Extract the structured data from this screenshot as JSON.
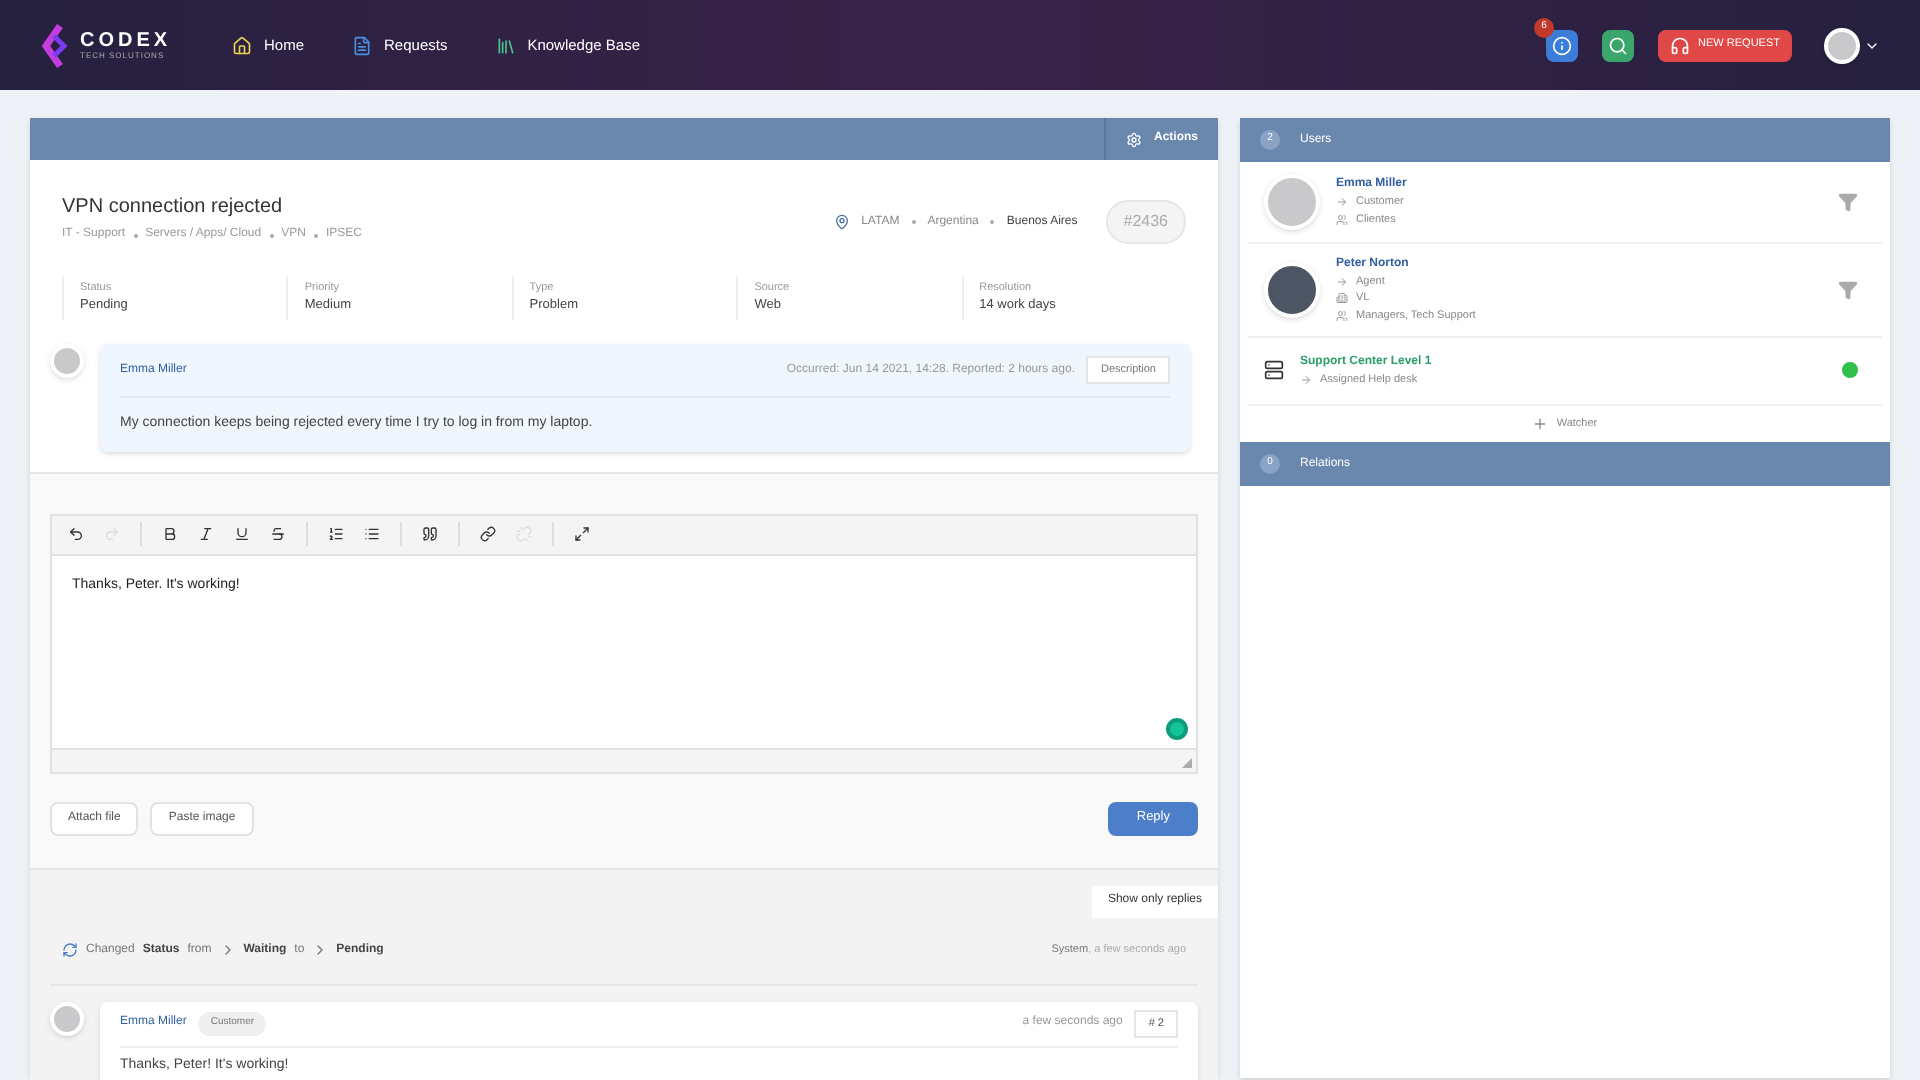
{
  "header": {
    "logo_name": "CODEX",
    "logo_tagline": "TECH SOLUTIONS",
    "nav": [
      {
        "label": "Home",
        "kind": "home"
      },
      {
        "label": "Requests",
        "kind": "requests"
      },
      {
        "label": "Knowledge Base",
        "kind": "books"
      }
    ],
    "notification_count": "6",
    "new_request": "NEW REQUEST"
  },
  "ticket": {
    "actions": "Actions",
    "title": "VPN connection rejected",
    "breadcrumb": [
      "IT - Support",
      "Servers / Apps/ Cloud",
      "VPN",
      "IPSEC"
    ],
    "location": [
      "LATAM",
      "Argentina",
      "Buenos Aires"
    ],
    "id": "#2436",
    "fields": [
      {
        "label": "Status",
        "value": "Pending"
      },
      {
        "label": "Priority",
        "value": "Medium"
      },
      {
        "label": "Type",
        "value": "Problem"
      },
      {
        "label": "Source",
        "value": "Web"
      },
      {
        "label": "Resolution",
        "value": "14 work days"
      }
    ]
  },
  "description": {
    "author": "Emma Miller",
    "meta": "Occurred: Jun 14 2021, 14:28. Reported: 2 hours ago.",
    "tag": "Description",
    "text": "My connection keeps being rejected every time I try to log in from my laptop."
  },
  "editor": {
    "toolbar_groups": [
      [
        {
          "kind": "undo",
          "disabled": false
        },
        {
          "kind": "redo",
          "disabled": true
        }
      ],
      [
        {
          "kind": "bold",
          "disabled": false
        },
        {
          "kind": "italic",
          "disabled": false
        },
        {
          "kind": "underline",
          "disabled": false
        },
        {
          "kind": "strike",
          "disabled": false
        }
      ],
      [
        {
          "kind": "ordered",
          "disabled": false
        },
        {
          "kind": "bullets",
          "disabled": false
        }
      ],
      [
        {
          "kind": "quote",
          "disabled": false
        }
      ],
      [
        {
          "kind": "link",
          "disabled": false
        },
        {
          "kind": "unlink",
          "disabled": true
        }
      ],
      [
        {
          "kind": "fullscreen",
          "disabled": false
        }
      ]
    ],
    "content": "Thanks, Peter. It's working!",
    "attach": "Attach file",
    "paste": "Paste image",
    "reply": "Reply"
  },
  "show_only_replies": "Show only replies",
  "activity": {
    "prefix": "Changed",
    "field": "Status",
    "from_word": "from",
    "old_value": "Waiting",
    "to_word": "to",
    "new_value": "Pending",
    "actor": "System",
    "time": ", a few seconds ago"
  },
  "reply": {
    "author": "Emma Miller",
    "role": "Customer",
    "time": "a few seconds ago",
    "number": "# 2",
    "text": "Thanks, Peter! It's working!"
  },
  "users": {
    "count": "2",
    "title": "Users",
    "watcher": "Watcher",
    "items": [
      {
        "kind": "person",
        "name": "Emma Miller",
        "lines": [
          {
            "kind": "role",
            "text": "Customer"
          },
          {
            "kind": "group",
            "text": "Clientes"
          }
        ]
      },
      {
        "kind": "person",
        "name": "Peter Norton",
        "lines": [
          {
            "kind": "role",
            "text": "Agent"
          },
          {
            "kind": "site",
            "text": "VL"
          },
          {
            "kind": "group",
            "text": "Managers, Tech Support"
          }
        ]
      },
      {
        "kind": "helpdesk",
        "name": "Support Center Level 1",
        "lines": [
          {
            "kind": "role",
            "text": "Assigned Help desk"
          }
        ],
        "online": true
      }
    ]
  },
  "relations": {
    "count": "0",
    "title": "Relations"
  }
}
